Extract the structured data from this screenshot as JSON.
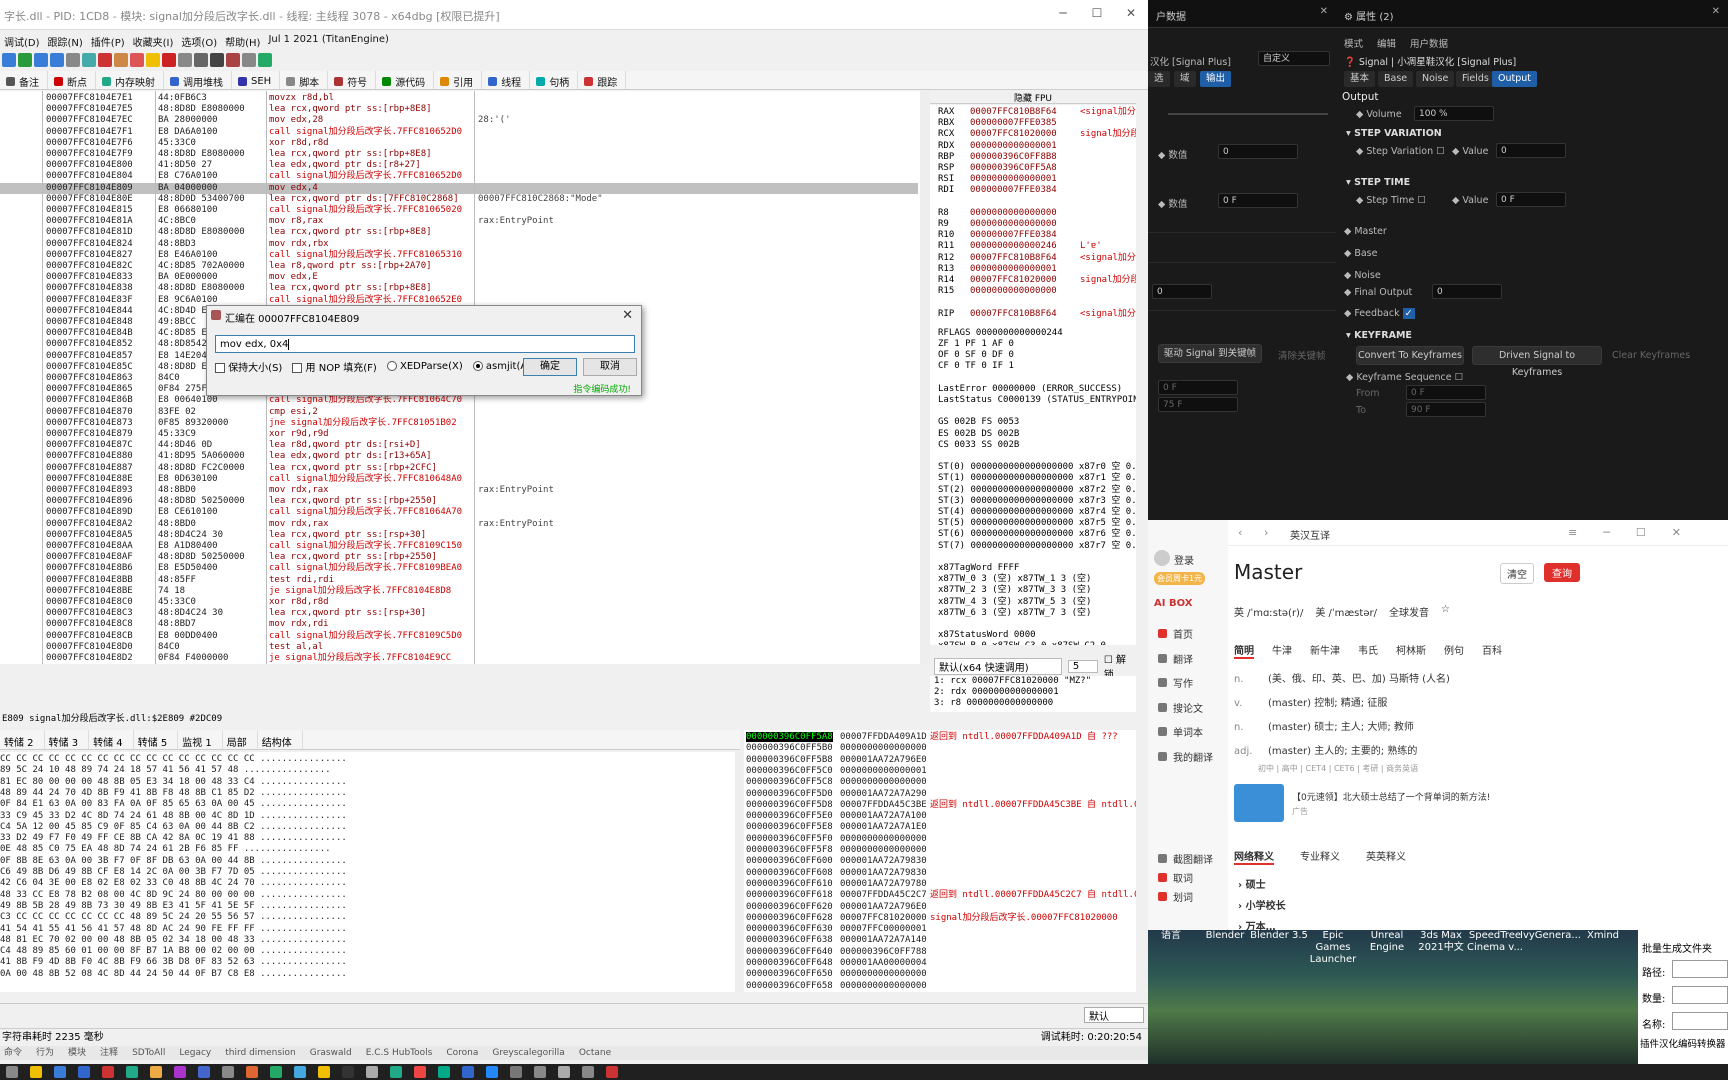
{
  "dbg": {
    "title": "字长.dll - PID: 1CD8 - 模块: signal加分段后改字长.dll - 线程: 主线程 3078 - x64dbg [权限已提升]",
    "menu": [
      "调试(D)",
      "跟踪(N)",
      "插件(P)",
      "收藏夹(I)",
      "选项(O)",
      "帮助(H)",
      "Jul 1 2021 (TitanEngine)"
    ],
    "tabs": [
      "备注",
      "断点",
      "内存映射",
      "调用堆栈",
      "SEH",
      "脚本",
      "符号",
      "源代码",
      "引用",
      "线程",
      "句柄",
      "跟踪"
    ],
    "disasm": [
      {
        "addr": "00007FFC8104E7E1",
        "bytes": "44:0FB6C3",
        "instr": "movzx r8d,bl",
        "cmt": "",
        "t": "n"
      },
      {
        "addr": "00007FFC8104E7E5",
        "bytes": "48:8D8D E8080000",
        "instr": "lea rcx,qword ptr ss:[rbp+8E8]",
        "cmt": "",
        "t": "n"
      },
      {
        "addr": "00007FFC8104E7EC",
        "bytes": "BA 28000000",
        "instr": "mov edx,28",
        "cmt": "28:'('",
        "t": "n"
      },
      {
        "addr": "00007FFC8104E7F1",
        "bytes": "E8 DA6A0100",
        "instr": "call signal加分段后改字长.7FFC810652D0",
        "cmt": "",
        "t": "call"
      },
      {
        "addr": "00007FFC8104E7F6",
        "bytes": "45:33C0",
        "instr": "xor r8d,r8d",
        "cmt": "",
        "t": "n"
      },
      {
        "addr": "00007FFC8104E7F9",
        "bytes": "48:8D8D E8080000",
        "instr": "lea rcx,qword ptr ss:[rbp+8E8]",
        "cmt": "",
        "t": "n"
      },
      {
        "addr": "00007FFC8104E800",
        "bytes": "41:8D50 27",
        "instr": "lea edx,qword ptr ds:[r8+27]",
        "cmt": "",
        "t": "n"
      },
      {
        "addr": "00007FFC8104E804",
        "bytes": "E8 C76A0100",
        "instr": "call signal加分段后改字长.7FFC810652D0",
        "cmt": "",
        "t": "call"
      },
      {
        "addr": "00007FFC8104E809",
        "bytes": "BA 04000000",
        "instr": "mov edx,4",
        "cmt": "",
        "t": "sel"
      },
      {
        "addr": "00007FFC8104E80E",
        "bytes": "48:8D0D 53400700",
        "instr": "lea rcx,qword ptr ds:[7FFC810C2868]",
        "cmt": "00007FFC810C2868:\"Mode\"",
        "t": "n"
      },
      {
        "addr": "00007FFC8104E815",
        "bytes": "E8 06680100",
        "instr": "call signal加分段后改字长.7FFC81065020",
        "cmt": "",
        "t": "call"
      },
      {
        "addr": "00007FFC8104E81A",
        "bytes": "4C:8BC0",
        "instr": "mov r8,rax",
        "cmt": "rax:EntryPoint",
        "t": "n"
      },
      {
        "addr": "00007FFC8104E81D",
        "bytes": "48:8D8D E8080000",
        "instr": "lea rcx,qword ptr ss:[rbp+8E8]",
        "cmt": "",
        "t": "n"
      },
      {
        "addr": "00007FFC8104E824",
        "bytes": "48:8BD3",
        "instr": "mov rdx,rbx",
        "cmt": "",
        "t": "n"
      },
      {
        "addr": "00007FFC8104E827",
        "bytes": "E8 E46A0100",
        "instr": "call signal加分段后改字长.7FFC81065310",
        "cmt": "",
        "t": "call"
      },
      {
        "addr": "00007FFC8104E82C",
        "bytes": "4C:8D85 702A0000",
        "instr": "lea r8,qword ptr ss:[rbp+2A70]",
        "cmt": "",
        "t": "n"
      },
      {
        "addr": "00007FFC8104E833",
        "bytes": "BA 0E000000",
        "instr": "mov edx,E",
        "cmt": "",
        "t": "n"
      },
      {
        "addr": "00007FFC8104E838",
        "bytes": "48:8D8D E8080000",
        "instr": "lea rcx,qword ptr ss:[rbp+8E8]",
        "cmt": "",
        "t": "n"
      },
      {
        "addr": "00007FFC8104E83F",
        "bytes": "E8 9C6A0100",
        "instr": "call signal加分段后改字长.7FFC810652E0",
        "cmt": "",
        "t": "call"
      },
      {
        "addr": "00007FFC8104E844",
        "bytes": "4C:8D4D E8",
        "instr": "",
        "cmt": "",
        "t": "n"
      },
      {
        "addr": "00007FFC8104E848",
        "bytes": "49:8BCC",
        "instr": "",
        "cmt": "",
        "t": "n"
      },
      {
        "addr": "00007FFC8104E84B",
        "bytes": "4C:8D85 E8",
        "instr": "",
        "cmt": "",
        "t": "n"
      },
      {
        "addr": "00007FFC8104E852",
        "bytes": "48:8D85424",
        "instr": "",
        "cmt": "",
        "t": "n"
      },
      {
        "addr": "00007FFC8104E857",
        "bytes": "E8 14E204",
        "instr": "",
        "cmt": "",
        "t": "n"
      },
      {
        "addr": "00007FFC8104E85C",
        "bytes": "48:8D8D E8",
        "instr": "",
        "cmt": "",
        "t": "n"
      },
      {
        "addr": "00007FFC8104E863",
        "bytes": "84C0",
        "instr": "",
        "cmt": "",
        "t": "n"
      },
      {
        "addr": "00007FFC8104E865",
        "bytes": "0F84 275F",
        "instr": "",
        "cmt": "",
        "t": "n"
      },
      {
        "addr": "00007FFC8104E86B",
        "bytes": "E8 00640100",
        "instr": "call signal加分段后改字长.7FFC81064C70",
        "cmt": "",
        "t": "call"
      },
      {
        "addr": "00007FFC8104E870",
        "bytes": "83FE 02",
        "instr": "cmp esi,2",
        "cmt": "",
        "t": "n"
      },
      {
        "addr": "00007FFC8104E873",
        "bytes": "0F85 89320000",
        "instr": "jne signal加分段后改字长.7FFC81051B02",
        "cmt": "",
        "t": "jmp"
      },
      {
        "addr": "00007FFC8104E879",
        "bytes": "45:33C9",
        "instr": "xor r9d,r9d",
        "cmt": "",
        "t": "n"
      },
      {
        "addr": "00007FFC8104E87C",
        "bytes": "44:8D46 0D",
        "instr": "lea r8d,qword ptr ds:[rsi+D]",
        "cmt": "",
        "t": "n"
      },
      {
        "addr": "00007FFC8104E880",
        "bytes": "41:8D95 5A060000",
        "instr": "lea edx,qword ptr ds:[r13+65A]",
        "cmt": "",
        "t": "n"
      },
      {
        "addr": "00007FFC8104E887",
        "bytes": "48:8D8D FC2C0000",
        "instr": "lea rcx,qword ptr ss:[rbp+2CFC]",
        "cmt": "",
        "t": "n"
      },
      {
        "addr": "00007FFC8104E88E",
        "bytes": "E8 0D630100",
        "instr": "call signal加分段后改字长.7FFC810648A0",
        "cmt": "",
        "t": "call"
      },
      {
        "addr": "00007FFC8104E893",
        "bytes": "48:8BD0",
        "instr": "mov rdx,rax",
        "cmt": "rax:EntryPoint",
        "t": "n"
      },
      {
        "addr": "00007FFC8104E896",
        "bytes": "48:8D8D 50250000",
        "instr": "lea rcx,qword ptr ss:[rbp+2550]",
        "cmt": "",
        "t": "n"
      },
      {
        "addr": "00007FFC8104E89D",
        "bytes": "E8 CE610100",
        "instr": "call signal加分段后改字长.7FFC81064A70",
        "cmt": "",
        "t": "call"
      },
      {
        "addr": "00007FFC8104E8A2",
        "bytes": "48:8BD0",
        "instr": "mov rdx,rax",
        "cmt": "rax:EntryPoint",
        "t": "n"
      },
      {
        "addr": "00007FFC8104E8A5",
        "bytes": "48:8D4C24 30",
        "instr": "lea rcx,qword ptr ss:[rsp+30]",
        "cmt": "",
        "t": "n"
      },
      {
        "addr": "00007FFC8104E8AA",
        "bytes": "E8 A1D80400",
        "instr": "call signal加分段后改字长.7FFC8109C150",
        "cmt": "",
        "t": "call"
      },
      {
        "addr": "00007FFC8104E8AF",
        "bytes": "48:8D8D 50250000",
        "instr": "lea rcx,qword ptr ss:[rbp+2550]",
        "cmt": "",
        "t": "n"
      },
      {
        "addr": "00007FFC8104E8B6",
        "bytes": "E8 E5D50400",
        "instr": "call signal加分段后改字长.7FFC8109BEA0",
        "cmt": "",
        "t": "call"
      },
      {
        "addr": "00007FFC8104E8BB",
        "bytes": "48:85FF",
        "instr": "test rdi,rdi",
        "cmt": "",
        "t": "n"
      },
      {
        "addr": "00007FFC8104E8BE",
        "bytes": "74 18",
        "instr": "je signal加分段后改字长.7FFC8104E8D8",
        "cmt": "",
        "t": "jmp"
      },
      {
        "addr": "00007FFC8104E8C0",
        "bytes": "45:33C0",
        "instr": "xor r8d,r8d",
        "cmt": "",
        "t": "n"
      },
      {
        "addr": "00007FFC8104E8C3",
        "bytes": "48:8D4C24 30",
        "instr": "lea rcx,qword ptr ss:[rsp+30]",
        "cmt": "",
        "t": "n"
      },
      {
        "addr": "00007FFC8104E8C8",
        "bytes": "48:8BD7",
        "instr": "mov rdx,rdi",
        "cmt": "",
        "t": "n"
      },
      {
        "addr": "00007FFC8104E8CB",
        "bytes": "E8 00DD0400",
        "instr": "call signal加分段后改字长.7FFC8109C5D0",
        "cmt": "",
        "t": "call"
      },
      {
        "addr": "00007FFC8104E8D0",
        "bytes": "84C0",
        "instr": "test al,al",
        "cmt": "",
        "t": "n"
      },
      {
        "addr": "00007FFC8104E8D2",
        "bytes": "0F84 F4000000",
        "instr": "je signal加分段后改字长.7FFC8104E9CC",
        "cmt": "",
        "t": "jmp"
      }
    ],
    "regs_header": "隐藏 FPU",
    "regs": [
      {
        "n": "RAX",
        "v": "00007FFC810B8F64",
        "c": "<signal加分"
      },
      {
        "n": "RBX",
        "v": "000000007FFE0385",
        "c": ""
      },
      {
        "n": "RCX",
        "v": "00007FFC81020000",
        "c": "signal加分段"
      },
      {
        "n": "RDX",
        "v": "0000000000000001",
        "c": ""
      },
      {
        "n": "RBP",
        "v": "000000396C0FF8B8",
        "c": ""
      },
      {
        "n": "RSP",
        "v": "000000396C0FF5A8",
        "c": ""
      },
      {
        "n": "RSI",
        "v": "0000000000000001",
        "c": ""
      },
      {
        "n": "RDI",
        "v": "000000007FFE0384",
        "c": ""
      },
      {
        "n": "",
        "v": "",
        "c": ""
      },
      {
        "n": "R8",
        "v": "0000000000000000",
        "c": ""
      },
      {
        "n": "R9",
        "v": "0000000000000000",
        "c": ""
      },
      {
        "n": "R10",
        "v": "000000007FFE0384",
        "c": ""
      },
      {
        "n": "R11",
        "v": "0000000000000246",
        "c": "L'ɐ'"
      },
      {
        "n": "R12",
        "v": "00007FFC810B8F64",
        "c": "<signal加分"
      },
      {
        "n": "R13",
        "v": "0000000000000001",
        "c": ""
      },
      {
        "n": "R14",
        "v": "00007FFC81020000",
        "c": "signal加分段"
      },
      {
        "n": "R15",
        "v": "0000000000000000",
        "c": ""
      },
      {
        "n": "",
        "v": "",
        "c": ""
      },
      {
        "n": "RIP",
        "v": "00007FFC810B8F64",
        "c": "<signal加分"
      }
    ],
    "flags": [
      "RFLAGS  0000000000000244",
      "ZF 1  PF 1  AF 0",
      "OF 0  SF 0  DF 0",
      "CF 0  TF 0  IF 1",
      "",
      "LastError  00000000 (ERROR_SUCCESS)",
      "LastStatus C0000139 (STATUS_ENTRYPOINT",
      "",
      "GS 002B  FS 0053",
      "ES 002B  DS 002B",
      "CS 0033  SS 002B",
      "",
      "ST(0) 0000000000000000000 x87r0 空 0.0",
      "ST(1) 0000000000000000000 x87r1 空 0.0",
      "ST(2) 0000000000000000000 x87r2 空 0.0",
      "ST(3) 0000000000000000000 x87r3 空 0.0",
      "ST(4) 0000000000000000000 x87r4 空 0.0",
      "ST(5) 0000000000000000000 x87r5 空 0.0",
      "ST(6) 0000000000000000000 x87r6 空 0.0",
      "ST(7) 0000000000000000000 x87r7 空 0.0",
      "",
      "x87TagWord FFFF",
      "x87TW_0 3 (空)       x87TW_1 3 (空)",
      "x87TW_2 3 (空)       x87TW_3 3 (空)",
      "x87TW_4 3 (空)       x87TW_5 3 (空)",
      "x87TW_6 3 (空)       x87TW_7 3 (空)",
      "",
      "x87StatusWord 0000",
      "x87SW_B 0  x87SW_C3  0  x87SW_C2  0",
      "x87SW_C1 0  x87SW_C0  0  x87SW_ES  0",
      "x87SW_SF 0  x87SW_P   0  x87SW_U   0"
    ],
    "callconv": "默认(x64 快速调用)",
    "callconv_n": "5",
    "unlock": "解锁",
    "args": [
      "1: rcx 00007FFC81020000 \"MZ?\"",
      "2: rdx 0000000000000001",
      "3: r8 0000000000000000"
    ],
    "cmdline": "E809 signal加分段后改字长.dll:$2E809 #2DC09",
    "dump_tabs": [
      "转储 2",
      "转储 3",
      "转储 4",
      "转储 5",
      "监视 1",
      "局部",
      "结构体"
    ],
    "dump_rows": [
      "CC CC CC CC CC CC CC CC CC CC CC CC CC CC CC CC  ................",
      "89 5C 24 10 48 89 74 24 18 57 41 56 41 57 48  ................",
      "81 EC 80 00 00 00 48 8B 05 E3 34 18 00 48 33 C4  ................",
      "48 89 44 24 70 4D 8B F9 41 8B F8 48 8B C1 85 D2  ................",
      "0F 84 E1 63 0A 00 83 FA 0A 0F 85 65 63 0A 00 45  ................",
      "33 C9 45 33 D2 4C 8D 74 24 61 48 8B 00 4C 8D 1D  ................",
      "C4 5A 12 00 45 85 C9 0F 85 C4 63 0A 00 44 8B C2  ................",
      "33 D2 49 F7 F0 49 FF CE 8B CA 42 8A 0C 19 41 88  ................",
      "0E 48 85 C0 75 EA 48 8D 74 24 61 2B F6 85 FF  ................",
      "0F 8B 8E 63 0A 00 3B F7 0F 8F DB 63 0A 00 44 8B  ................",
      "C6 49 8B D6 49 8B CF E8 14 2C 0A 00 3B F7 7D 05  ................",
      "42 C6 04 3E 00 E8 02 E8 02 33 C0 48 8B 4C 24 70  ................",
      "48 33 CC E8 78 B2 08 00 4C 8D 9C 24 80 00 00 00  ................",
      "49 8B 5B 28 49 8B 73 30 49 8B E3 41 5F 41 5E 5F  ................",
      "C3 CC CC CC CC CC CC CC 48 89 5C 24 20 55 56 57  ................",
      "41 54 41 55 41 56 41 57 48 8D AC 24 90 FE FF FF  ................",
      "48 81 EC 70 02 00 00 48 8B 05 02 34 18 00 48 33  ................",
      "C4 48 89 85 60 01 00 00 8F B7 1A B8 00 02 00 00  ................",
      "41 8B F9 4D 8B F0 4C 8B F9 66 3B D8 0F 83 52 63  ................",
      "0A 00 48 8B 52 08 4C 8D 44 24 50 44 0F B7 C8 E8  ................"
    ],
    "stack_rows": [
      {
        "a": "000000396C0FF5A8",
        "v": "00007FFDDA409A1D",
        "c": "返回到 ntdll.00007FFDDA409A1D 自 ???"
      },
      {
        "a": "000000396C0FF5B0",
        "v": "0000000000000000",
        "c": ""
      },
      {
        "a": "000000396C0FF5B8",
        "v": "000001AA72A796E0",
        "c": ""
      },
      {
        "a": "000000396C0FF5C0",
        "v": "0000000000000001",
        "c": ""
      },
      {
        "a": "000000396C0FF5C8",
        "v": "0000000000000000",
        "c": ""
      },
      {
        "a": "000000396C0FF5D0",
        "v": "000001AA72A7A290",
        "c": ""
      },
      {
        "a": "000000396C0FF5D8",
        "v": "00007FFDDA45C3BE",
        "c": "返回到 ntdll.00007FFDDA45C3BE 自 ntdll.0"
      },
      {
        "a": "000000396C0FF5E0",
        "v": "000001AA72A7A100",
        "c": ""
      },
      {
        "a": "000000396C0FF5E8",
        "v": "000001AA72A7A1E0",
        "c": ""
      },
      {
        "a": "000000396C0FF5F0",
        "v": "0000000000000000",
        "c": ""
      },
      {
        "a": "000000396C0FF5F8",
        "v": "0000000000000000",
        "c": ""
      },
      {
        "a": "000000396C0FF600",
        "v": "000001AA72A79830",
        "c": ""
      },
      {
        "a": "000000396C0FF608",
        "v": "000001AA72A79830",
        "c": ""
      },
      {
        "a": "000000396C0FF610",
        "v": "000001AA72A79780",
        "c": ""
      },
      {
        "a": "000000396C0FF618",
        "v": "00007FFDDA45C2C7",
        "c": "返回到 ntdll.00007FFDDA45C2C7 自 ntdll.0"
      },
      {
        "a": "000000396C0FF620",
        "v": "000001AA72A796E0",
        "c": ""
      },
      {
        "a": "000000396C0FF628",
        "v": "00007FFC81020000",
        "c": "signal加分段后改字长.00007FFC81020000"
      },
      {
        "a": "000000396C0FF630",
        "v": "00007FFC00000001",
        "c": ""
      },
      {
        "a": "000000396C0FF638",
        "v": "000001AA72A7A140",
        "c": ""
      },
      {
        "a": "000000396C0FF640",
        "v": "000000396C0FF788",
        "c": ""
      },
      {
        "a": "000000396C0FF648",
        "v": "000001AA00000004",
        "c": ""
      },
      {
        "a": "000000396C0FF650",
        "v": "0000000000000000",
        "c": ""
      },
      {
        "a": "000000396C0FF658",
        "v": "0000000000000000",
        "c": ""
      }
    ],
    "status_left": "字符串耗时 2235 毫秒",
    "status_right": "调试耗时:  0:20:20:54",
    "status_default": "默认",
    "bottom_tabs": [
      "命令",
      "行为",
      "模块",
      "注释",
      "SDToAll",
      "Legacy",
      "third dimension",
      "Graswald",
      "E.C.S HubTools",
      "Corona",
      "Greyscalegorilla",
      "Octane"
    ]
  },
  "dialog": {
    "title": "汇编在 00007FFC8104E809",
    "value": "mov edx, 0x4",
    "opt1": "保持大小(S)",
    "opt2": "用 NOP 填充(F)",
    "opt3": "XEDParse(X)",
    "opt4": "asmjit(A)",
    "ok": "确定",
    "cancel": "取消",
    "status": "指令编码成功!"
  },
  "unreal_left": {
    "header": "户数据",
    "title": "汉化 [Signal Plus]",
    "preset": "自定义",
    "tabs": [
      "选",
      "域",
      "输出"
    ],
    "num1_label": "数值",
    "num1": "0",
    "num2_label": "数值",
    "num2": "0 F",
    "val3": "0",
    "btn1": "驱动 Signal 到关键帧",
    "btn2": "清除关键帧",
    "f1": "0 F",
    "f2": "75 F"
  },
  "unreal_right": {
    "title": "属性 (2)",
    "menu": [
      "模式",
      "编辑",
      "用户数据"
    ],
    "subtitle": "Signal | 小凋星鞋汉化 [Signal Plus]",
    "tabs": [
      "基本",
      "Base",
      "Noise",
      "Fields",
      "Output"
    ],
    "section": "Output",
    "volume_label": "Volume",
    "volume": "100 %",
    "step_variation": "STEP VARIATION",
    "step_var_label": "Step Variation",
    "value_label": "Value",
    "value1": "0",
    "step_time": "STEP TIME",
    "step_time_label": "Step Time",
    "value2": "0 F",
    "master": "Master",
    "base": "Base",
    "noise": "Noise",
    "final_output": "Final Output",
    "final_output_val": "0",
    "feedback": "Feedback",
    "keyframe": "KEYFRAME",
    "btn_convert": "Convert To Keyframes",
    "btn_driven": "Driven Signal to Keyframes",
    "btn_clear": "Clear Keyframes",
    "kf_seq": "Keyframe Sequence",
    "from": "From",
    "from_v": "0 F",
    "to": "To",
    "to_v": "90 F"
  },
  "dict": {
    "nav": "英汉互译",
    "login": "登录",
    "vip": "会员周卡1元",
    "ai": "AI BOX",
    "side": [
      "首页",
      "翻译",
      "写作",
      "搜论文",
      "单词本",
      "我的翻译"
    ],
    "side2": [
      "截图翻译",
      "取词",
      "划词"
    ],
    "word": "Master",
    "clear": "清空",
    "query": "查询",
    "phon_uk": "英 /ˈmɑːstə(r)/",
    "phon_us": "美 /ˈmæstər/",
    "all": "全球发音",
    "dict_tabs": [
      "简明",
      "牛津",
      "新牛津",
      "韦氏",
      "柯林斯",
      "例句",
      "百科"
    ],
    "defs": [
      {
        "p": "n.",
        "d": "(美、俄、印、英、巴、加) 马斯特 (人名)"
      },
      {
        "p": "v.",
        "d": "(master) 控制; 精通; 征服"
      },
      {
        "p": "n.",
        "d": "(master) 硕士; 主人; 大师; 教师"
      },
      {
        "p": "adj.",
        "d": "(master) 主人的; 主要的; 熟练的"
      }
    ],
    "tags": "初中 | 高中 | CET4 | CET6 | 考研 | 商务英语",
    "ad": "【0元速领】北大硕士总结了一个背单词的新方法!",
    "ad_label": "广告",
    "net_tabs": [
      "网络释义",
      "专业释义",
      "英英释义"
    ],
    "net": [
      "硕士",
      "小学校长",
      "万本…"
    ]
  },
  "desktop": {
    "icons": [
      "语言",
      "Blender",
      "Blender 3.5",
      "Epic Games Launcher",
      "Unreal Engine",
      "3ds Max 2021中文",
      "SpeedTree Cinema v...",
      "IvyGenera...",
      "Xmind"
    ]
  },
  "batch": {
    "title": "批量生成文件夹",
    "path": "路径:",
    "count": "数量:",
    "name": "名称:",
    "footer": "插件汉化编码转换器"
  }
}
